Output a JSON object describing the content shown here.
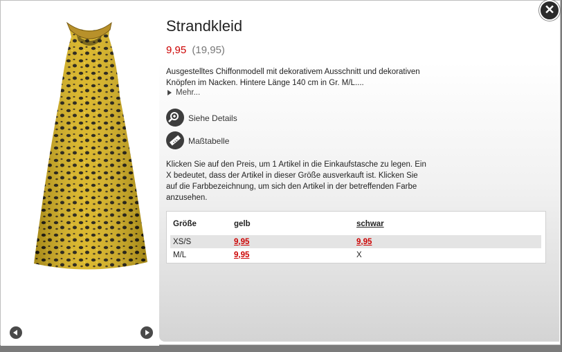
{
  "product": {
    "title": "Strandkleid",
    "price": "9,95",
    "old_price": "(19,95)",
    "description": "Ausgestelltes Chiffonmodell mit dekorativem Ausschnitt und dekorativen Knöpfen im Nacken. Hintere Länge 140 cm in Gr. M/L....",
    "more_label": "Mehr..."
  },
  "actions": {
    "details_label": "Siehe Details",
    "size_chart_label": "Maßtabelle",
    "details_icon": "magnifier-icon",
    "size_chart_icon": "ruler-icon"
  },
  "instructions": "Klicken Sie auf den Preis, um 1 Artikel in die Einkaufstasche zu legen. Ein X bedeutet, dass der Artikel in dieser Größe ausverkauft ist. Klicken Sie auf die Farbbezeichnung, um sich den Artikel in der betreffenden Farbe anzusehen.",
  "size_table": {
    "headers": [
      "Größe",
      "gelb",
      "schwar"
    ],
    "rows": [
      {
        "size": "XS/S",
        "gelb": "9,95",
        "schwarz": "9,95"
      },
      {
        "size": "M/L",
        "gelb": "9,95",
        "schwarz": "X"
      }
    ]
  },
  "colors": {
    "price": "#cc0000",
    "dress_yellow": "#d8b21d",
    "dress_spots": "#1e1a0e"
  },
  "icons": {
    "close": "close-icon",
    "prev": "arrow-left-icon",
    "next": "arrow-right-icon"
  }
}
